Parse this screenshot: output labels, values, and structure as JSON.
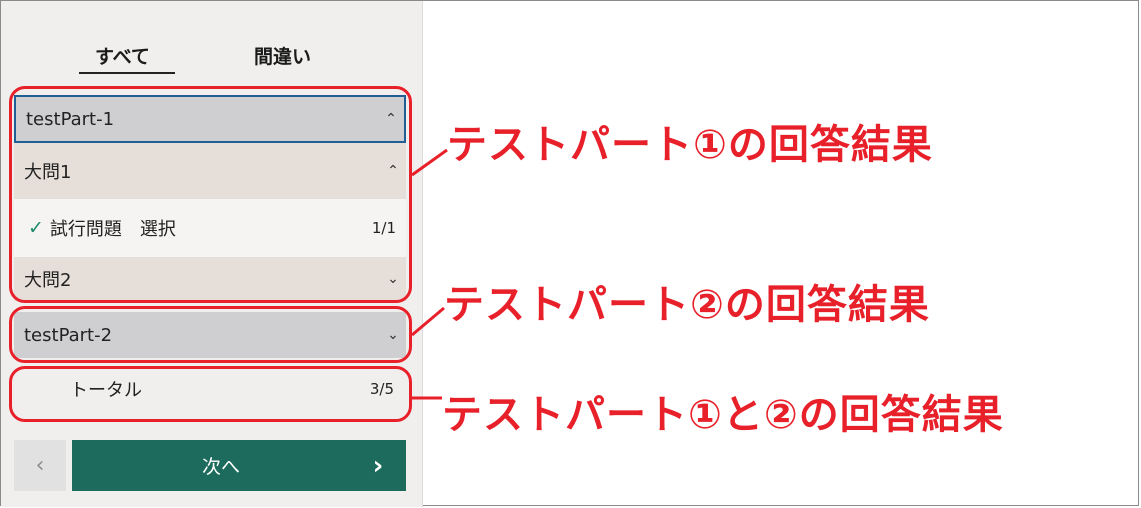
{
  "tabs": {
    "all": "すべて",
    "wrong": "間違い"
  },
  "tree": {
    "part1": {
      "label": "testPart-1"
    },
    "q1": {
      "label": "大問1"
    },
    "item": {
      "label": "試行問題　選択",
      "count": "1/1"
    },
    "q2": {
      "label": "大問2"
    },
    "part2": {
      "label": "testPart-2"
    },
    "total": {
      "label": "トータル",
      "count": "3/5"
    }
  },
  "nav": {
    "next_label": "次へ",
    "prev_icon": "chevron-left-icon",
    "next_icon": "chevron-right-icon"
  },
  "annotations": {
    "part1_result": "テストパート①の回答結果",
    "part2_result": "テストパート②の回答結果",
    "total_result": "テストパート①と②の回答結果"
  },
  "colors": {
    "annotation_red": "#e8202a",
    "next_button": "#1d6b5c",
    "check_green": "#1e8b6a",
    "focus_blue": "#1f5f95"
  }
}
